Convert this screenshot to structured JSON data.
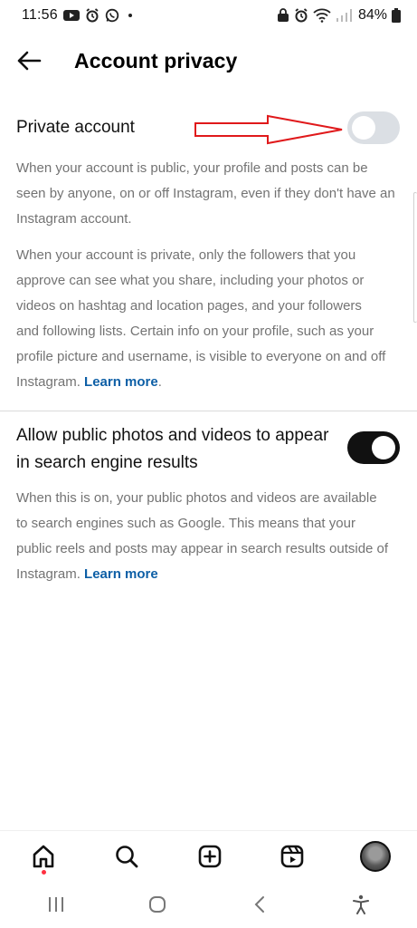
{
  "status_bar": {
    "time": "11:56",
    "battery": "84%",
    "left_icons": [
      "youtube-icon",
      "alarm-icon",
      "whatsapp-icon"
    ],
    "right_icons": [
      "lock-icon",
      "alarm-icon",
      "wifi-icon",
      "signal-icon",
      "battery-icon"
    ]
  },
  "header": {
    "title": "Account privacy",
    "back_icon": "back-arrow-icon"
  },
  "private_account": {
    "label": "Private account",
    "toggle_state": "off",
    "annotation": "red-arrow-pointing-to-toggle",
    "description_1": "When your account is public, your profile and posts can be seen by anyone, on or off Instagram, even if they don't have an Instagram account.",
    "description_2_lines": [
      "When your account is private, only the followers that you",
      "approve can see what you share, including your photos or",
      "videos on hashtag and location pages, and your followers",
      "and following lists. Certain info on your profile, such as your",
      "profile picture and username, is visible to everyone on and off"
    ],
    "description_2_last": "Instagram. ",
    "learn_more": "Learn more",
    "learn_more_suffix": "."
  },
  "search_engine": {
    "label_line_1": "Allow public photos and videos to appear",
    "label_line_2": "in search engine results",
    "toggle_state": "on",
    "description_lines": [
      "When this is on, your public photos and videos are available",
      "to search engines such as Google. This means that your",
      "public reels and posts may appear in search results outside of"
    ],
    "description_last": "Instagram. ",
    "learn_more": "Learn more"
  },
  "bottom_nav": {
    "items": [
      "home-icon",
      "search-icon",
      "create-icon",
      "reels-icon",
      "profile-avatar"
    ],
    "active": "home-icon",
    "notification_dot_color": "#ff3040"
  },
  "system_nav": {
    "items": [
      "recent-apps-icon",
      "home-button-icon",
      "back-icon",
      "accessibility-icon"
    ]
  },
  "colors": {
    "link": "#0d5fa6",
    "secondary_text": "#737373",
    "toggle_on": "#111111",
    "toggle_off": "#dbdfe4",
    "arrow": "#e0191b"
  }
}
